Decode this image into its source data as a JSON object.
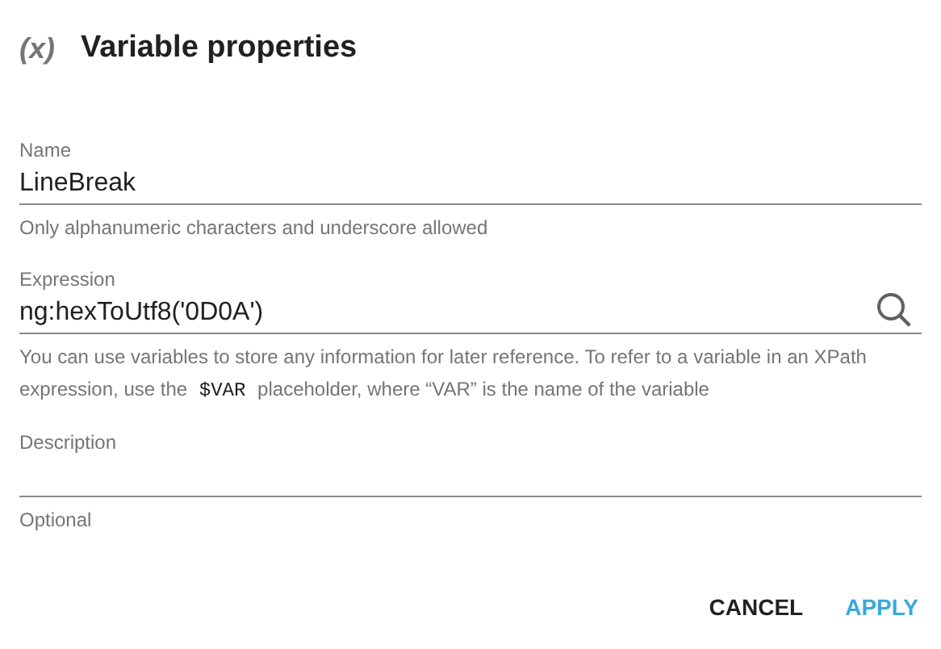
{
  "dialog": {
    "icon": "(x)",
    "title": "Variable properties"
  },
  "fields": [
    {
      "kind": "text",
      "label": "Name",
      "value": "LineBreak",
      "hint": [
        {
          "kind": "text",
          "text": "Only alphanumeric characters and underscore allowed"
        }
      ]
    },
    {
      "kind": "search",
      "label": "Expression",
      "value": "ng:hexToUtf8('0D0A')",
      "hint": [
        {
          "kind": "text",
          "text": "You can use variables to store any information for later reference. To refer to a variable in an XPath expression, use the "
        },
        {
          "kind": "code",
          "text": "$VAR"
        },
        {
          "kind": "text",
          "text": " placeholder, where “VAR” is the name of the variable"
        }
      ]
    },
    {
      "kind": "text",
      "label": "Description",
      "hint": [
        {
          "kind": "text",
          "text": "Optional"
        }
      ]
    }
  ],
  "buttons": [
    {
      "label": "CANCEL",
      "kind": "plain"
    },
    {
      "label": "APPLY",
      "kind": "primary"
    }
  ]
}
